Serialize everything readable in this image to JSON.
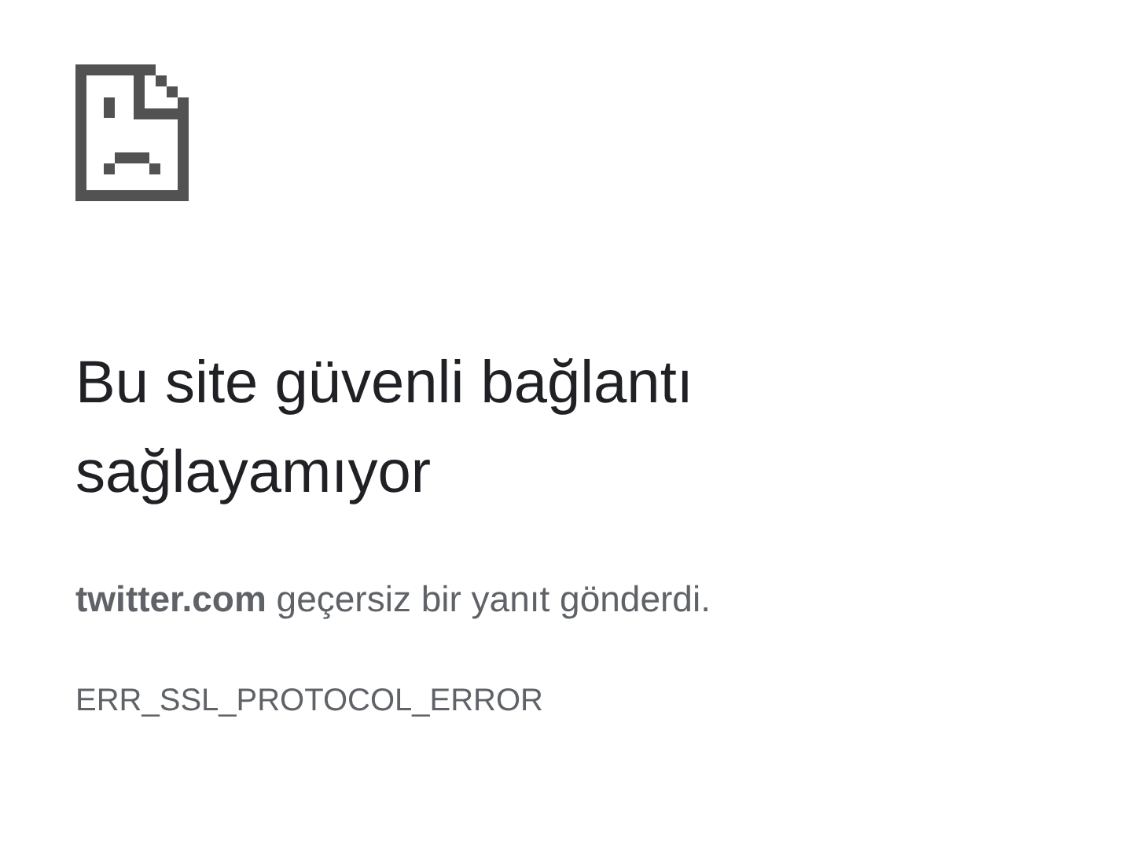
{
  "heading": "Bu site güvenli bağlantı sağlayamıyor",
  "message": "**twitter.com** geçersiz bir yanıt gönderdi.",
  "error_code": "ERR_SSL_PROTOCOL_ERROR"
}
